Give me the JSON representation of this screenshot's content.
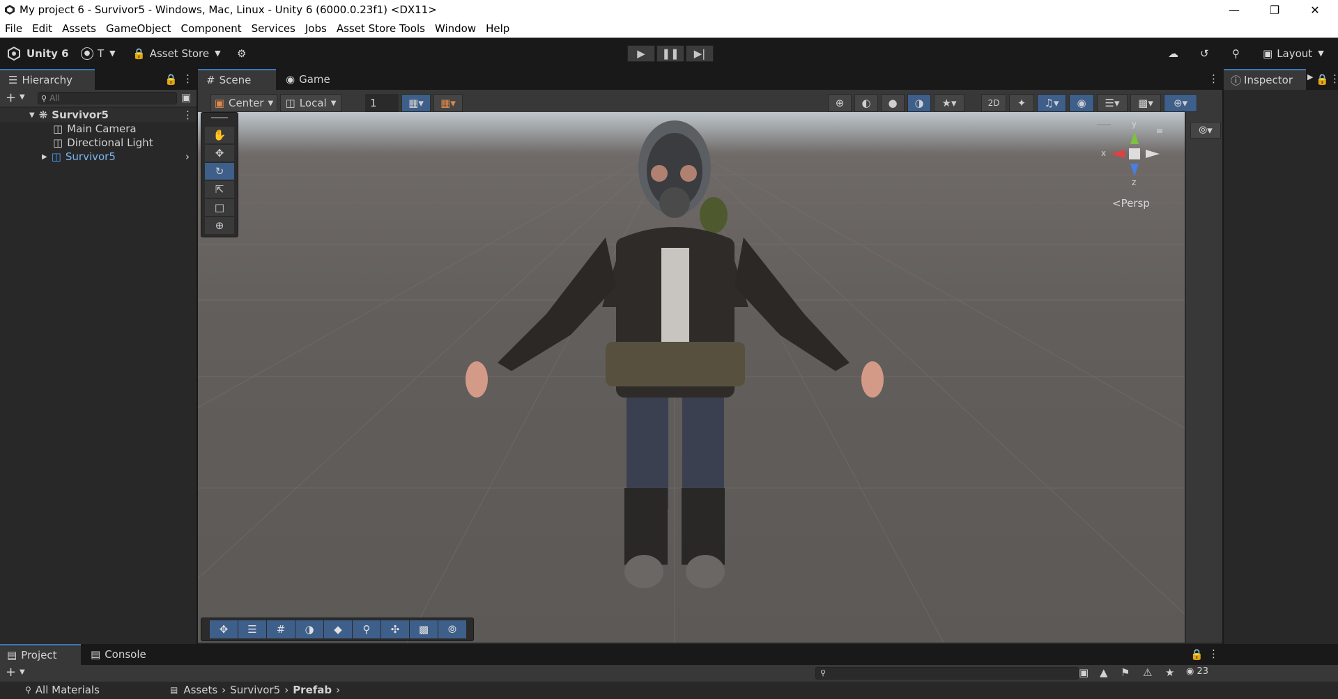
{
  "window": {
    "title": "My project 6 - Survivor5 - Windows, Mac, Linux - Unity 6 (6000.0.23f1) <DX11>"
  },
  "menu": [
    "File",
    "Edit",
    "Assets",
    "GameObject",
    "Component",
    "Services",
    "Jobs",
    "Asset Store Tools",
    "Window",
    "Help"
  ],
  "toolbar": {
    "brand": "Unity 6",
    "account": "T",
    "asset_store": "Asset Store",
    "layout": "Layout"
  },
  "hierarchy": {
    "tab": "Hierarchy",
    "search_placeholder": "All",
    "rows": [
      {
        "label": "Survivor5",
        "kind": "scene"
      },
      {
        "label": "Main Camera",
        "kind": "object"
      },
      {
        "label": "Directional Light",
        "kind": "object"
      },
      {
        "label": "Survivor5",
        "kind": "prefab"
      }
    ]
  },
  "scene": {
    "tabs": [
      "Scene",
      "Game"
    ],
    "pivot": "Center",
    "space": "Local",
    "grid_size": "1",
    "gizmo": {
      "y": "y",
      "x": "x",
      "z": "z",
      "persp": "<Persp"
    }
  },
  "inspector": {
    "tab": "Inspector"
  },
  "project": {
    "tabs": [
      "Project",
      "Console"
    ],
    "left_item": "All Materials",
    "breadcrumb": [
      "Assets",
      "Survivor5",
      "Prefab"
    ],
    "count": "23"
  },
  "colors": {
    "accent": "#3a79bb",
    "prefab_text": "#7ab5f0",
    "active_button": "#3e5f8a"
  }
}
